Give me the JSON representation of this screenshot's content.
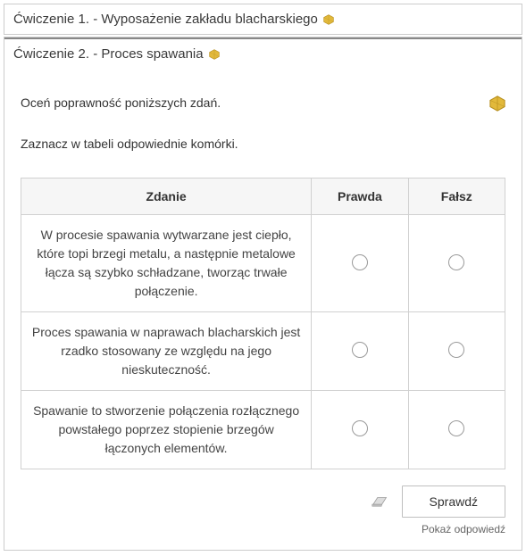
{
  "exercises": [
    {
      "title": "Ćwiczenie 1. - Wyposażenie zakładu blacharskiego"
    },
    {
      "title": "Ćwiczenie 2. - Proces spawania"
    }
  ],
  "instruction": "Oceń poprawność poniższych zdań.",
  "sub_instruction": "Zaznacz w tabeli odpowiednie komórki.",
  "table": {
    "headers": {
      "statement": "Zdanie",
      "true": "Prawda",
      "false": "Fałsz"
    },
    "rows": [
      {
        "statement": "W procesie spawania wytwarzane jest ciepło, które topi brzegi metalu, a następnie metalowe łącza są szybko schładzane, tworząc trwałe połączenie."
      },
      {
        "statement": "Proces spawania w naprawach blacharskich jest rzadko stosowany ze względu na jego nieskuteczność."
      },
      {
        "statement": "Spawanie to stworzenie połączenia rozłącznego powstałego poprzez stopienie brzegów łączonych elementów."
      }
    ]
  },
  "controls": {
    "check_label": "Sprawdź",
    "show_answer_label": "Pokaż odpowiedź"
  },
  "colors": {
    "dice_accent": "#E2B93B"
  }
}
